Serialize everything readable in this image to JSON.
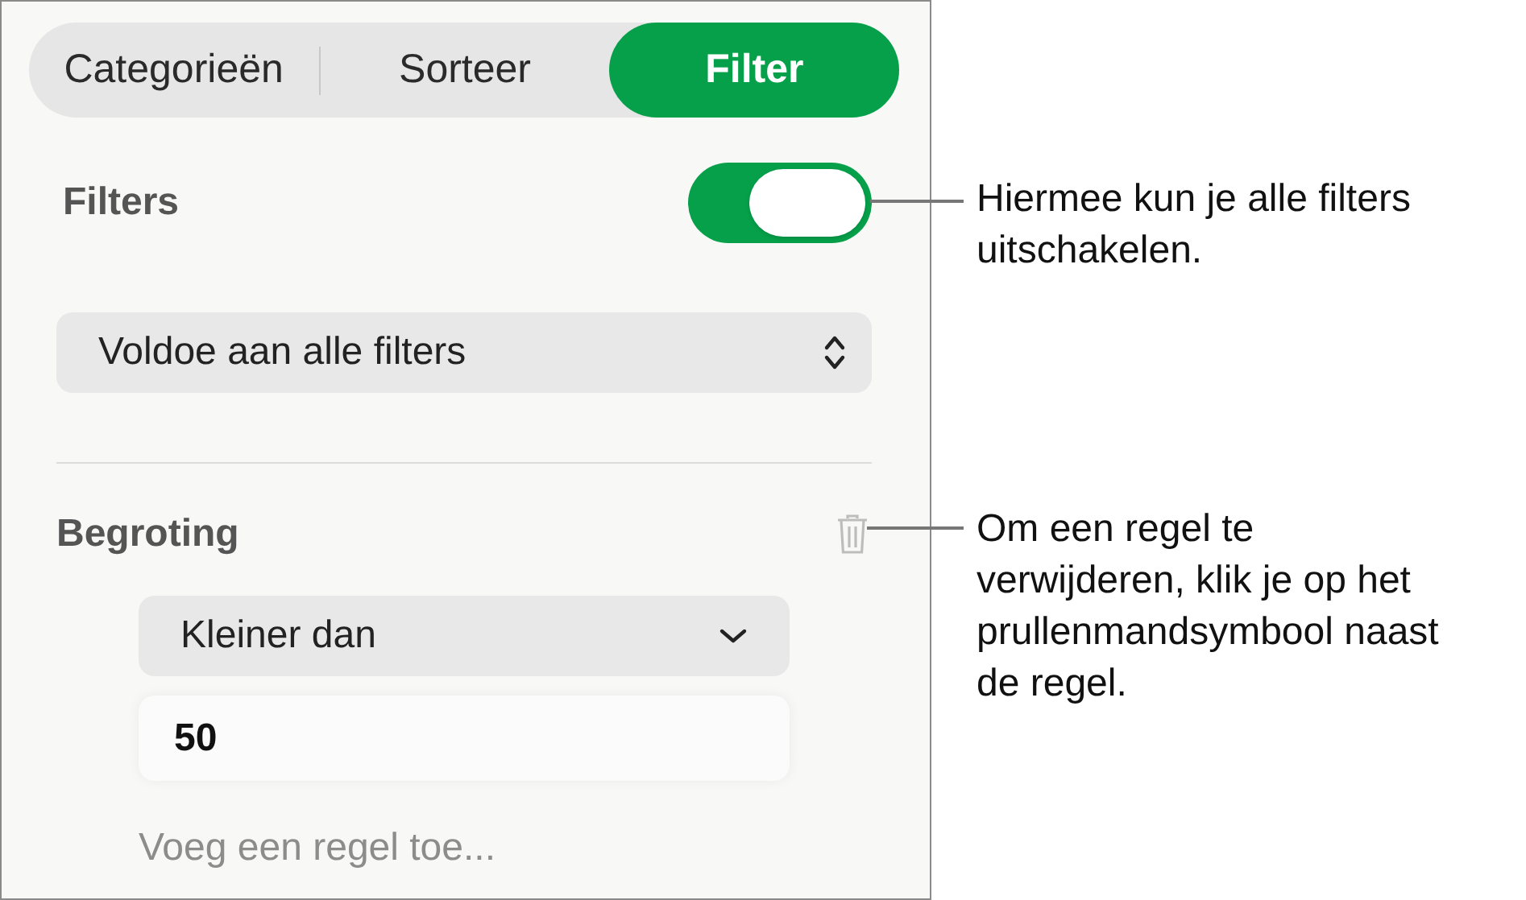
{
  "tabs": [
    {
      "label": "Categorieën",
      "selected": false
    },
    {
      "label": "Sorteer",
      "selected": false
    },
    {
      "label": "Filter",
      "selected": true
    }
  ],
  "filters": {
    "label": "Filters",
    "on": true
  },
  "match_select": {
    "value": "Voldoe aan alle filters"
  },
  "rule": {
    "column": "Begroting",
    "operator": "Kleiner dan",
    "value": "50"
  },
  "add_rule": "Voeg een regel toe...",
  "callouts": [
    {
      "text": "Hiermee kun je alle filters uitschakelen."
    },
    {
      "text": "Om een regel te verwijderen, klik je op het prullenmandsymbool naast de regel."
    }
  ]
}
